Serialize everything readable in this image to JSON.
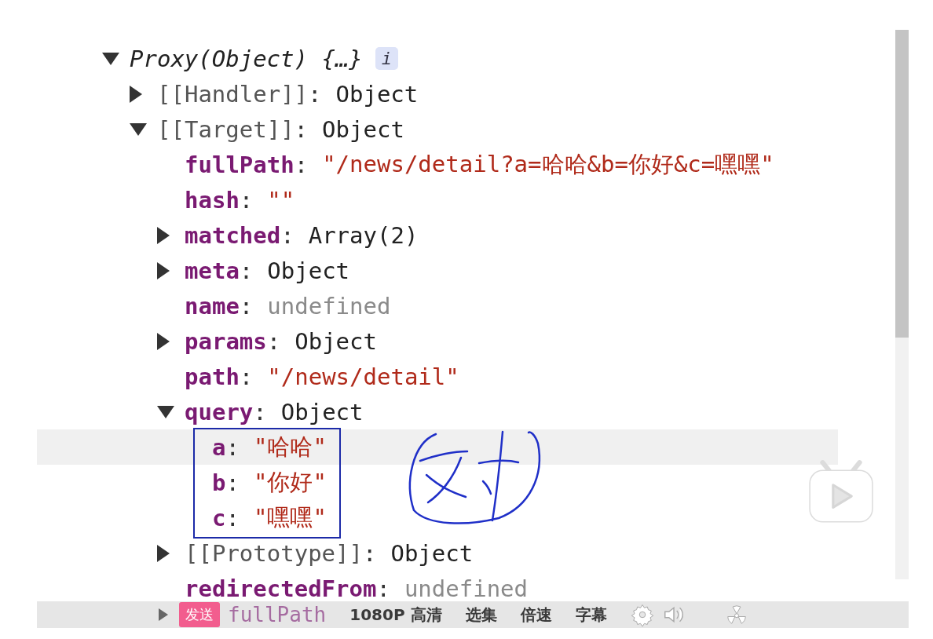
{
  "console": {
    "root": {
      "label": "Proxy(Object) {…}",
      "badge": "i",
      "expanded": true,
      "children": [
        {
          "key": "[[Handler]]",
          "colon": ":",
          "kind": "internal",
          "value": "Object",
          "color": "#222222",
          "expanded": false
        },
        {
          "key": "[[Target]]",
          "colon": ":",
          "kind": "internal",
          "value": "Object",
          "color": "#222222",
          "expanded": true,
          "children": [
            {
              "key": "fullPath",
              "colon": ":",
              "kind": "property",
              "value": "\"/news/detail?a=哈哈&b=你好&c=嘿嘿\"",
              "color": "#b02a1a"
            },
            {
              "key": "hash",
              "colon": ":",
              "kind": "property",
              "value": "\"\"",
              "color": "#b02a1a"
            },
            {
              "key": "matched",
              "colon": ":",
              "kind": "property",
              "value": "Array(2)",
              "color": "#222222",
              "expanded": false
            },
            {
              "key": "meta",
              "colon": ":",
              "kind": "property",
              "value": "Object",
              "color": "#222222",
              "expanded": false
            },
            {
              "key": "name",
              "colon": ":",
              "kind": "property",
              "value": "undefined",
              "color": "#8a8a8a"
            },
            {
              "key": "params",
              "colon": ":",
              "kind": "property",
              "value": "Object",
              "color": "#222222",
              "expanded": false
            },
            {
              "key": "path",
              "colon": ":",
              "kind": "property",
              "value": "\"/news/detail\"",
              "color": "#b02a1a"
            },
            {
              "key": "query",
              "colon": ":",
              "kind": "property",
              "value": "Object",
              "color": "#222222",
              "expanded": true,
              "annotated": true,
              "children": [
                {
                  "key": "a",
                  "colon": ":",
                  "kind": "property",
                  "value": "\"哈哈\"",
                  "color": "#b02a1a",
                  "highlighted": true
                },
                {
                  "key": "b",
                  "colon": ":",
                  "kind": "property",
                  "value": "\"你好\"",
                  "color": "#b02a1a",
                  "highlighted": false
                },
                {
                  "key": "c",
                  "colon": ":",
                  "kind": "property",
                  "value": "\"嘿嘿\"",
                  "color": "#b02a1a",
                  "highlighted": false
                }
              ]
            },
            {
              "key": "[[Prototype]]",
              "colon": ":",
              "kind": "internal",
              "value": "Object",
              "color": "#222222",
              "expanded": false
            },
            {
              "key": "redirectedFrom",
              "colon": ":",
              "kind": "property",
              "value": "undefined",
              "color": "#8a8a8a"
            }
          ]
        }
      ]
    }
  },
  "player_bar": {
    "send_label": "发送",
    "behind_text": "fullPath",
    "controls": [
      "1080P 高清",
      "选集",
      "倍速",
      "字幕"
    ]
  }
}
